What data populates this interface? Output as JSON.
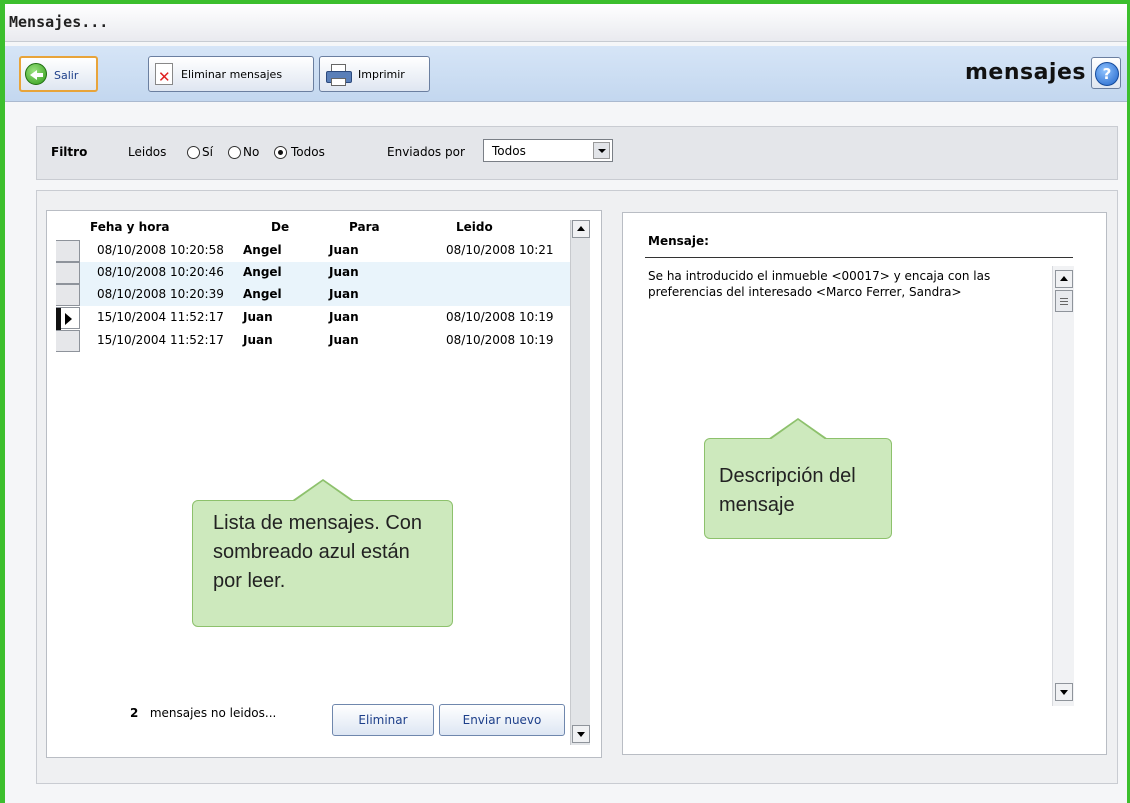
{
  "window": {
    "title": "Mensajes..."
  },
  "toolbar": {
    "exit_label": "Salir",
    "delete_label": "Eliminar mensajes",
    "print_label": "Imprimir",
    "app_title": "mensajes",
    "help_icon": "help-icon"
  },
  "filter": {
    "title": "Filtro",
    "read_label": "Leidos",
    "options": [
      "Sí",
      "No",
      "Todos"
    ],
    "selected": "Todos",
    "sent_by_label": "Enviados por",
    "sent_by_value": "Todos"
  },
  "grid": {
    "columns": [
      "Feha y hora",
      "De",
      "Para",
      "Leido"
    ],
    "rows": [
      {
        "fecha": "08/10/2008 10:20:58",
        "de": "Angel",
        "para": "Juan",
        "leido": "08/10/2008 10:21",
        "unread": false,
        "current": false
      },
      {
        "fecha": "08/10/2008 10:20:46",
        "de": "Angel",
        "para": "Juan",
        "leido": "",
        "unread": true,
        "current": false
      },
      {
        "fecha": "08/10/2008 10:20:39",
        "de": "Angel",
        "para": "Juan",
        "leido": "",
        "unread": true,
        "current": false
      },
      {
        "fecha": "15/10/2004 11:52:17",
        "de": "Juan",
        "para": "Juan",
        "leido": "08/10/2008 10:19",
        "unread": false,
        "current": true
      },
      {
        "fecha": "15/10/2004 11:52:17",
        "de": "Juan",
        "para": "Juan",
        "leido": "08/10/2008 10:19",
        "unread": false,
        "current": false
      }
    ]
  },
  "footer": {
    "unread_count": "2",
    "unread_text": "mensajes no leidos...",
    "delete_button": "Eliminar",
    "new_button": "Enviar nuevo"
  },
  "message": {
    "label": "Mensaje:",
    "text": "Se ha introducido el inmueble <00017> y encaja con las preferencias del interesado <Marco Ferrer, Sandra>"
  },
  "callouts": {
    "list": "Lista de mensajes. Con sombreado azul están por leer.",
    "desc": "Descripción del mensaje"
  },
  "colors": {
    "frame": "#3cbf2d",
    "unread_row": "#e9f4fb",
    "callout": "#cde9bd"
  }
}
